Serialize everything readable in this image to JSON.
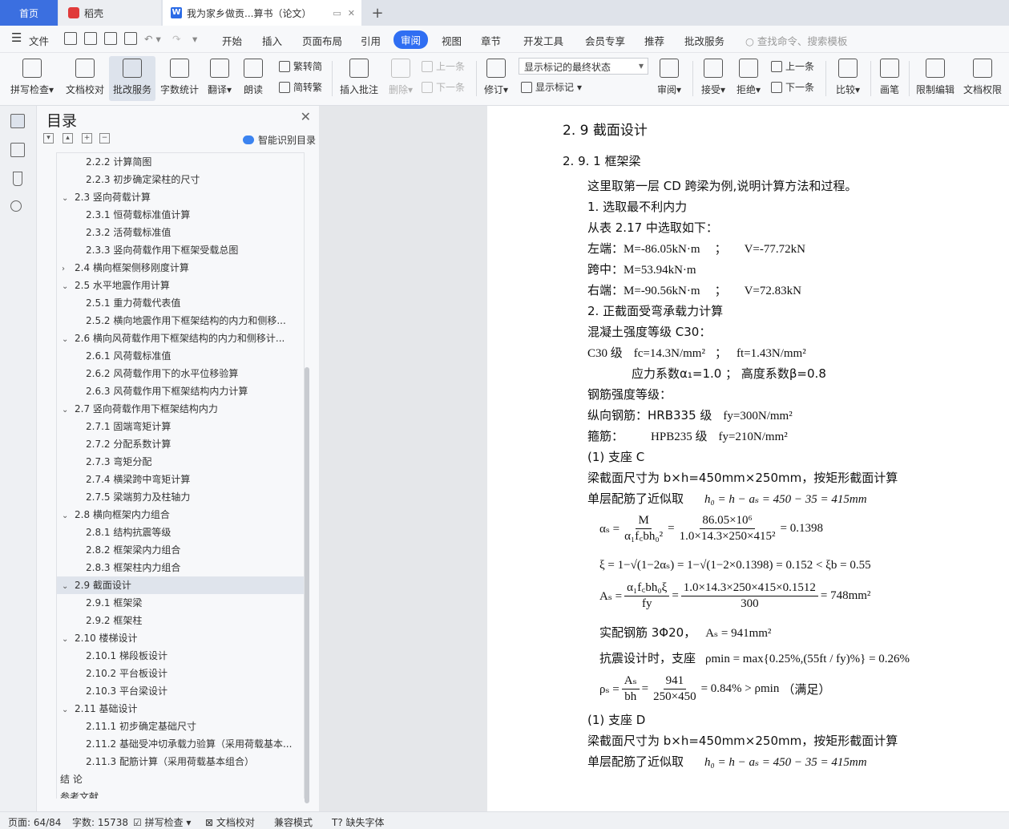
{
  "tabs": {
    "home": "首页",
    "daoke": "稻壳",
    "doc_title": "我为家乡做贡...算书（论文）"
  },
  "menu": {
    "file": "文件",
    "items": [
      "开始",
      "插入",
      "页面布局",
      "引用",
      "审阅",
      "视图",
      "章节",
      "开发工具",
      "会员专享",
      "推荐",
      "批改服务"
    ],
    "search_placeholder": "查找命令、搜索模板"
  },
  "toolbar": {
    "spell": "拼写检查",
    "proof": "文档校对",
    "correct": "批改服务",
    "wordcount": "字数统计",
    "translate": "翻译",
    "read": "朗读",
    "trad": "繁转简",
    "simp": "简转繁",
    "insert_comment": "插入批注",
    "delete": "删除",
    "prev_comment": "上一条",
    "next_comment": "下一条",
    "revise": "修订",
    "markup_state": "显示标记的最终状态",
    "show_markup": "显示标记",
    "review": "审阅",
    "accept": "接受",
    "reject": "拒绝",
    "prev_change": "上一条",
    "next_change": "下一条",
    "compare": "比较",
    "pen": "画笔",
    "restrict": "限制编辑",
    "permission": "文档权限"
  },
  "toc": {
    "title": "目录",
    "smart": "智能识别目录",
    "items": [
      {
        "label": "2.2.2  计算简图",
        "level": 3
      },
      {
        "label": "2.2.3  初步确定梁柱的尺寸",
        "level": 3
      },
      {
        "label": "2.3  竖向荷载计算",
        "level": 2,
        "open": true
      },
      {
        "label": "2.3.1  恒荷载标准值计算",
        "level": 3
      },
      {
        "label": "2.3.2  活荷载标准值",
        "level": 3
      },
      {
        "label": "2.3.3  竖向荷载作用下框架受载总图",
        "level": 3
      },
      {
        "label": "2.4  横向框架侧移刚度计算",
        "level": 2
      },
      {
        "label": "2.5  水平地震作用计算",
        "level": 2,
        "open": true
      },
      {
        "label": "2.5.1 重力荷载代表值",
        "level": 3
      },
      {
        "label": "2.5.2    横向地震作用下框架结构的内力和侧移...",
        "level": 3
      },
      {
        "label": "2.6    横向风荷载作用下框架结构的内力和侧移计...",
        "level": 2,
        "open": true
      },
      {
        "label": "2.6.1 风荷载标准值",
        "level": 3
      },
      {
        "label": "2.6.2  风荷载作用下的水平位移验算",
        "level": 3
      },
      {
        "label": "2.6.3 风荷载作用下框架结构内力计算",
        "level": 3
      },
      {
        "label": "2.7  竖向荷载作用下框架结构内力",
        "level": 2,
        "open": true
      },
      {
        "label": "2.7.1  固端弯矩计算",
        "level": 3
      },
      {
        "label": "2.7.2  分配系数计算",
        "level": 3
      },
      {
        "label": "2.7.3  弯矩分配",
        "level": 3
      },
      {
        "label": "2.7.4    横梁跨中弯矩计算",
        "level": 3
      },
      {
        "label": "2.7.5  梁端剪力及柱轴力",
        "level": 3
      },
      {
        "label": "2.8  横向框架内力组合",
        "level": 2,
        "open": true
      },
      {
        "label": "2.8.1  结构抗震等级",
        "level": 3
      },
      {
        "label": "2.8.2  框架梁内力组合",
        "level": 3
      },
      {
        "label": "2.8.3  框架柱内力组合",
        "level": 3
      },
      {
        "label": "2.9  截面设计",
        "level": 2,
        "open": true,
        "selected": true
      },
      {
        "label": "2.9.1  框架梁",
        "level": 3
      },
      {
        "label": "2.9.2  框架柱",
        "level": 3
      },
      {
        "label": "2.10  楼梯设计",
        "level": 2,
        "open": true
      },
      {
        "label": "2.10.1  梯段板设计",
        "level": 3
      },
      {
        "label": "2.10.2  平台板设计",
        "level": 3
      },
      {
        "label": "2.10.3  平台梁设计",
        "level": 3
      },
      {
        "label": "2.11  基础设计",
        "level": 2,
        "open": true
      },
      {
        "label": "2.11.1  初步确定基础尺寸",
        "level": 3
      },
      {
        "label": "2.11.2  基础受冲切承载力验算（采用荷载基本...",
        "level": 3
      },
      {
        "label": "2.11.3  配筋计算（采用荷载基本组合）",
        "level": 3
      },
      {
        "label": "结    论",
        "level": 1
      },
      {
        "label": "参考文献",
        "level": 1
      }
    ]
  },
  "doc": {
    "h1": "2. 9  截面设计",
    "h2": "2. 9. 1  框架梁",
    "p1": "这里取第一层 CD 跨梁为例,说明计算方法和过程。",
    "p2": "1.  选取最不利内力",
    "p3": "从表 2.17 中选取如下：",
    "left_end": "左端：",
    "left_M": "M=-86.05kN·m",
    "left_V": "V=-77.72kN",
    "mid": "跨中：",
    "mid_M": "M=53.94kN·m",
    "right_end": "右端：",
    "right_M": "M=-90.56kN·m",
    "right_V": "V=72.83kN",
    "semicolon": "；",
    "p4": "2.  正截面受弯承载力计算",
    "p5": "混凝土强度等级 C30：",
    "c30": "C30 级",
    "fc": "fc=14.3N/mm²",
    "ft": "ft=1.43N/mm²",
    "alpha_line": "应力系数α₁=1.0  ；  高度系数β=0.8",
    "p6": "钢筋强度等级：",
    "long_bar": "纵向钢筋：HRB335 级",
    "fy1": "fy=300N/mm²",
    "stirrup": "箍筋：",
    "hpb": "HPB235 级",
    "fy2": "fy=210N/mm²",
    "supC": "(1)  支座 C",
    "section1": "梁截面尺寸为 b×h=450mm×250mm，按矩形截面计算",
    "single1": "单层配筋了近似取",
    "h0_1": "h₀ = h − aₛ = 450 − 35 = 415mm",
    "eq_as_lhs": "αₛ =",
    "eq_as_num": "M",
    "eq_as_den": "α₁f꜀bh₀²",
    "eq_as_num2": "86.05×10⁶",
    "eq_as_den2": "1.0×14.3×250×415²",
    "eq_as_res": "= 0.1398",
    "eq_xi": "ξ = 1−√(1−2αₛ) = 1−√(1−2×0.1398) = 0.152 < ξb = 0.55",
    "eq_As_lhs": "Aₛ =",
    "eq_As_num": "α₁f꜀bh₀ξ",
    "eq_As_den": "fy",
    "eq_As_num2": "1.0×14.3×250×415×0.1512",
    "eq_As_den2": "300",
    "eq_As_res": "= 748mm²",
    "actual": "实配钢筋 3Φ20，",
    "actual_As": "Aₛ = 941mm²",
    "seismic": "抗震设计时，支座",
    "rho_min": "ρmin = max{0.25%,(55ft / fy)%} = 0.26%",
    "eq_rho_lhs": "ρₛ =",
    "eq_rho_num": "Aₛ",
    "eq_rho_den": "bh",
    "eq_rho_num2": "941",
    "eq_rho_den2": "250×450",
    "eq_rho_res": "= 0.84% > ρmin",
    "satisfied": "（满足）",
    "supD": "(1)  支座 D",
    "section2": "梁截面尺寸为 b×h=450mm×250mm，按矩形截面计算",
    "single2": "单层配筋了近似取",
    "h0_2": "h₀ = h − aₛ = 450 − 35 = 415mm"
  },
  "status": {
    "page": "页面: 64/84",
    "words": "字数: 15738",
    "spell": "拼写检查",
    "proof": "文档校对",
    "compat": "兼容模式",
    "missing_font": "缺失字体"
  }
}
